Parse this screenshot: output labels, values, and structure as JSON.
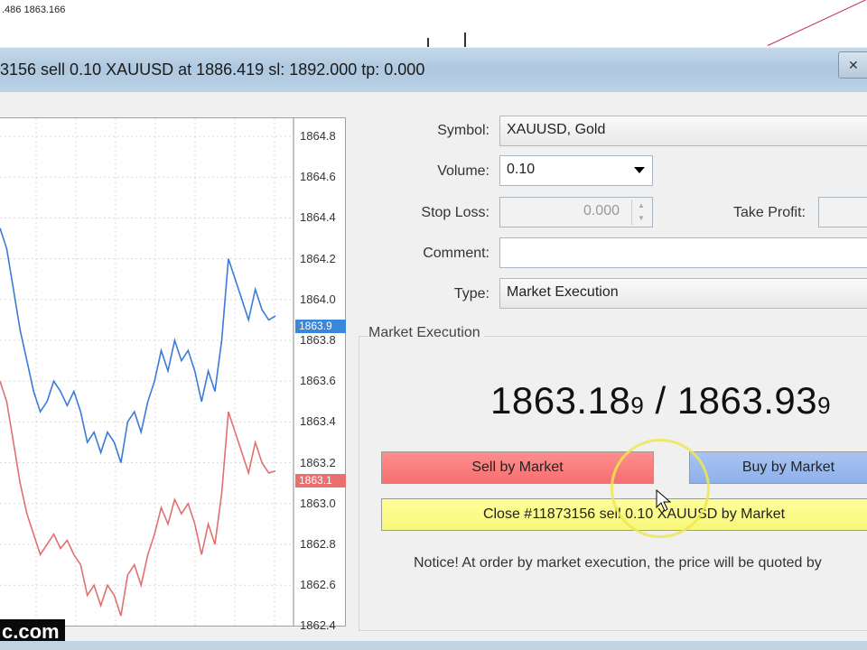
{
  "background": {
    "chart_label": ".486 1863.166"
  },
  "window": {
    "title": "3156 sell 0.10 XAUUSD at 1886.419 sl: 1892.000 tp: 0.000",
    "close_icon": "close-icon"
  },
  "chart": {
    "price_labels": [
      "1864.8",
      "1864.6",
      "1864.4",
      "1864.2",
      "1864.0",
      "1863.8",
      "1863.6",
      "1863.4",
      "1863.2",
      "1863.0",
      "1862.8",
      "1862.6",
      "1862.4"
    ],
    "ask_tag": "1863.9",
    "bid_tag": "1863.1",
    "colors": {
      "ask": "#3a7ad8",
      "bid": "#e07070",
      "grid": "#d8d8d8"
    },
    "ask_series": [
      1864.35,
      1864.25,
      1864.05,
      1863.85,
      1863.7,
      1863.55,
      1863.45,
      1863.5,
      1863.6,
      1863.55,
      1863.48,
      1863.55,
      1863.45,
      1863.3,
      1863.35,
      1863.25,
      1863.35,
      1863.3,
      1863.2,
      1863.4,
      1863.45,
      1863.35,
      1863.5,
      1863.6,
      1863.75,
      1863.65,
      1863.8,
      1863.7,
      1863.75,
      1863.65,
      1863.5,
      1863.65,
      1863.55,
      1863.8,
      1864.2,
      1864.1,
      1864.0,
      1863.9,
      1864.05,
      1863.95,
      1863.9,
      1863.92
    ],
    "bid_series": [
      1863.6,
      1863.5,
      1863.3,
      1863.1,
      1862.95,
      1862.85,
      1862.75,
      1862.8,
      1862.85,
      1862.78,
      1862.82,
      1862.75,
      1862.7,
      1862.55,
      1862.6,
      1862.5,
      1862.6,
      1862.55,
      1862.45,
      1862.65,
      1862.7,
      1862.6,
      1862.75,
      1862.85,
      1862.98,
      1862.9,
      1863.02,
      1862.95,
      1863.0,
      1862.9,
      1862.75,
      1862.9,
      1862.8,
      1863.05,
      1863.45,
      1863.35,
      1863.25,
      1863.15,
      1863.3,
      1863.2,
      1863.15,
      1863.16
    ]
  },
  "form": {
    "symbol_label": "Symbol:",
    "symbol_value": "XAUUSD, Gold",
    "volume_label": "Volume:",
    "volume_value": "0.10",
    "stoploss_label": "Stop Loss:",
    "stoploss_value": "0.000",
    "takeprofit_label": "Take Profit:",
    "comment_label": "Comment:",
    "comment_value": "",
    "type_label": "Type:",
    "type_value": "Market Execution"
  },
  "execution": {
    "section_title": "Market Execution",
    "bid_main": "1863.18",
    "bid_small": "9",
    "separator": " / ",
    "ask_main": "1863.93",
    "ask_small": "9",
    "sell_label": "Sell by Market",
    "buy_label": "Buy by Market",
    "close_label": "Close #11873156 sell 0.10 XAUUSD by Market",
    "notice": "Notice! At order by market execution, the price will be quoted by"
  },
  "watermark": "c.com"
}
